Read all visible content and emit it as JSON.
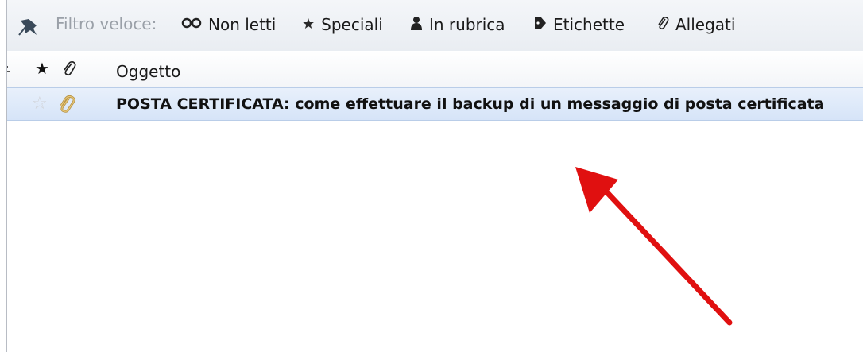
{
  "filter_bar": {
    "label": "Filtro veloce:",
    "buttons": [
      {
        "label": "Non letti",
        "icon": "unread-icon"
      },
      {
        "label": "Speciali",
        "icon": "star-icon"
      },
      {
        "label": "In rubrica",
        "icon": "contact-icon"
      },
      {
        "label": "Etichette",
        "icon": "tag-icon"
      },
      {
        "label": "Allegati",
        "icon": "paperclip-icon"
      }
    ]
  },
  "columns": {
    "subject_label": "Oggetto"
  },
  "messages": [
    {
      "subject": "POSTA CERTIFICATA: come effettuare il backup di un messaggio di posta certificata",
      "starred": false,
      "has_attachment": true
    }
  ],
  "annotation": {
    "arrow_color": "#e01010"
  },
  "colors": {
    "selection": "#d6e4f8",
    "attachment_icon": "#b8954a"
  }
}
